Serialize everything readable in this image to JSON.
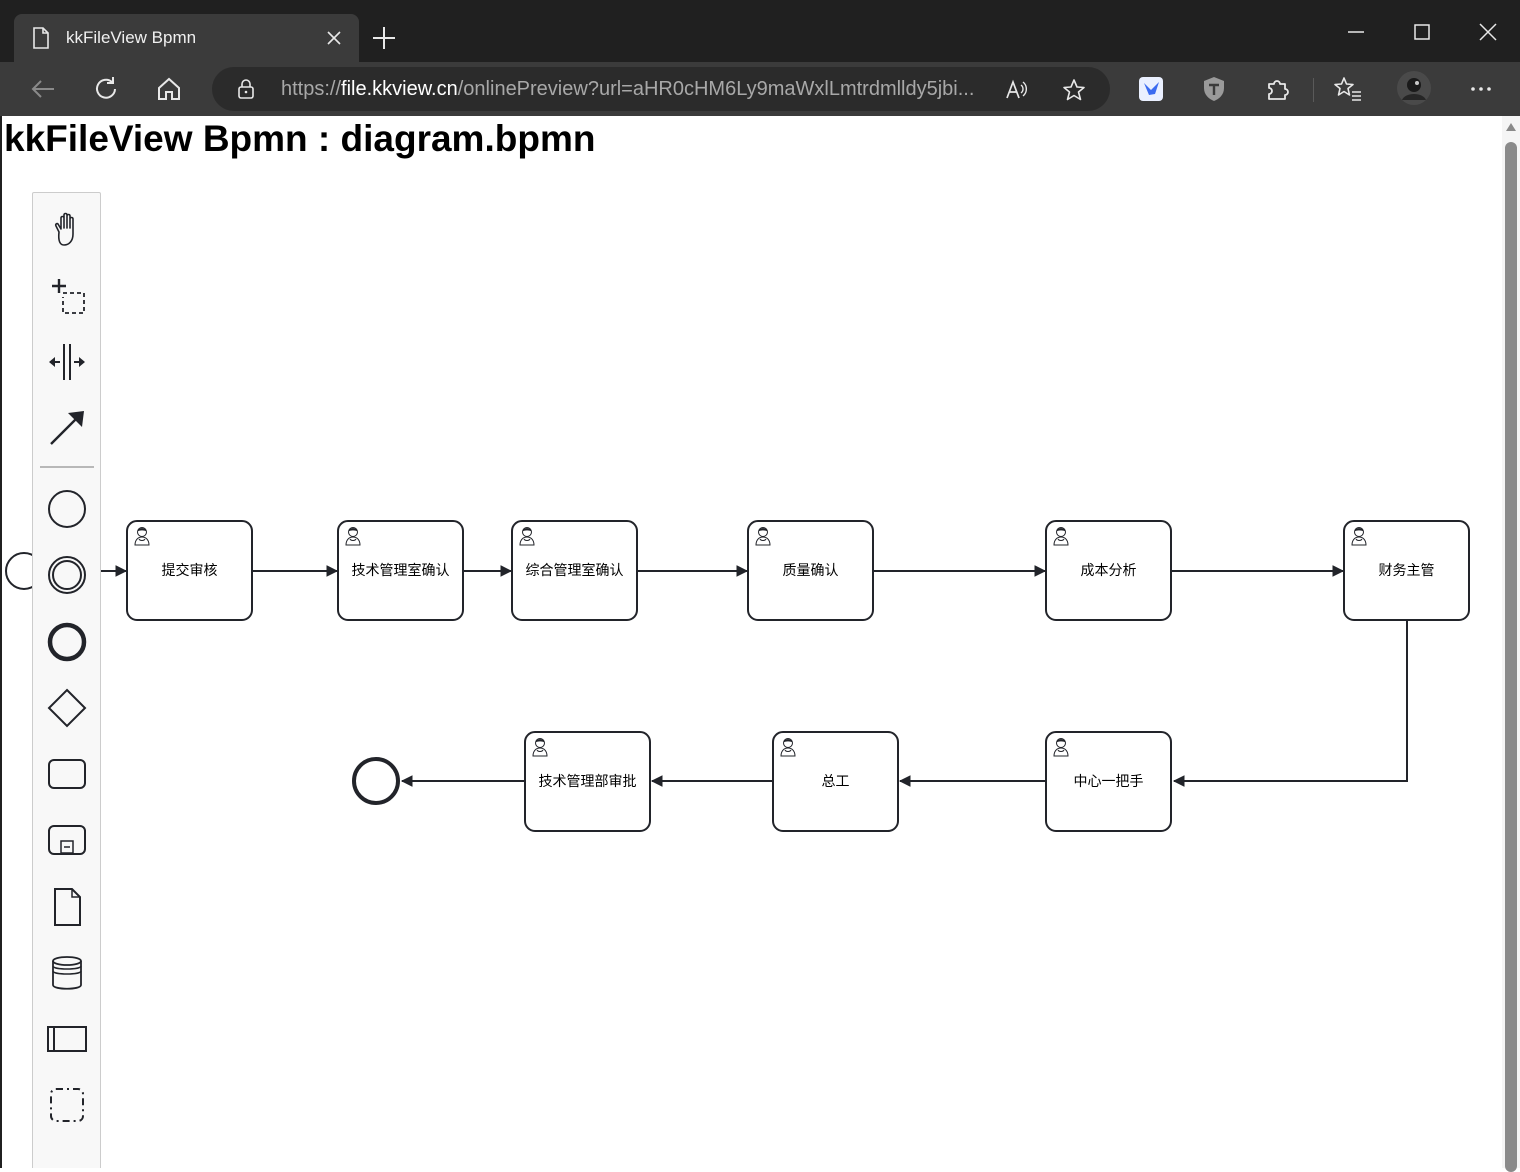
{
  "browser": {
    "tab_title": "kkFileView Bpmn",
    "url_prefix": "https://",
    "url_host": "file.kkview.cn",
    "url_path": "/onlinePreview?url=aHR0cHM6Ly9maWxlLmtrdmlldy5jbi..."
  },
  "page": {
    "title": "kkFileView Bpmn : diagram.bpmn"
  },
  "palette": {
    "tools": [
      "hand-tool",
      "lasso-tool",
      "space-tool",
      "global-connect-tool"
    ],
    "shapes": [
      "start-event",
      "intermediate-event",
      "end-event",
      "gateway",
      "task",
      "subprocess",
      "data-object",
      "data-store",
      "pool",
      "group"
    ]
  },
  "diagram": {
    "tasks": [
      {
        "id": "t1",
        "label": "提交审核"
      },
      {
        "id": "t2",
        "label": "技术管理室确认"
      },
      {
        "id": "t3",
        "label": "综合管理室确认"
      },
      {
        "id": "t4",
        "label": "质量确认"
      },
      {
        "id": "t5",
        "label": "成本分析"
      },
      {
        "id": "t6",
        "label": "财务主管"
      },
      {
        "id": "t7",
        "label": "中心一把手"
      },
      {
        "id": "t8",
        "label": "总工"
      },
      {
        "id": "t9",
        "label": "技术管理部审批"
      }
    ],
    "flow": [
      "start",
      "t1",
      "t2",
      "t3",
      "t4",
      "t5",
      "t6",
      "t7",
      "t8",
      "t9",
      "end"
    ],
    "colors": {
      "stroke": "#22242a",
      "fill": "#ffffff"
    }
  }
}
